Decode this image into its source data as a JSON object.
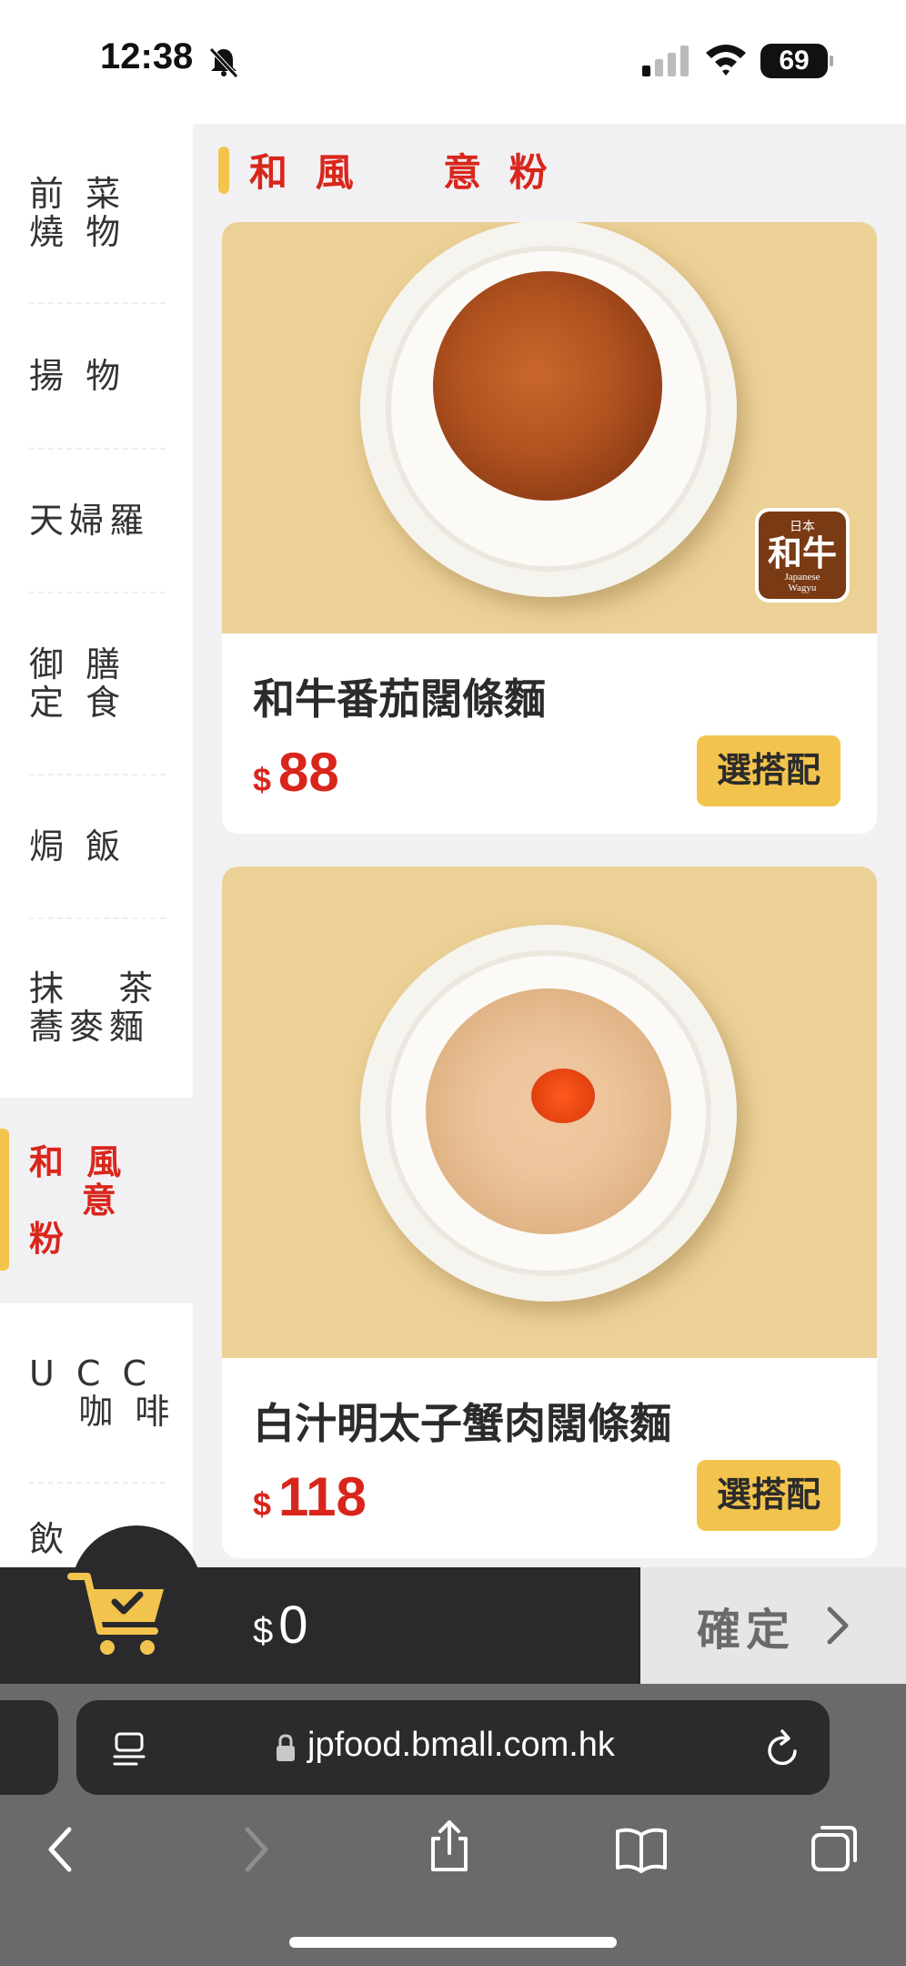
{
  "status_bar": {
    "time": "12:38",
    "battery": "69"
  },
  "sidebar": {
    "items": [
      {
        "label": "前 菜\n燒 物",
        "active": false
      },
      {
        "label": "揚 物",
        "active": false
      },
      {
        "label": "天婦羅",
        "active": false
      },
      {
        "label": "御 膳\n定 食",
        "active": false
      },
      {
        "label": "焗 飯",
        "active": false
      },
      {
        "label": "抹   茶\n蕎麥麵",
        "active": false
      },
      {
        "label": "和 風\n   意\n粉",
        "active": true
      },
      {
        "label": "U C C\n   咖 啡",
        "active": false
      },
      {
        "label": "飲",
        "active": false
      }
    ]
  },
  "section": {
    "title": "和 風    意 粉"
  },
  "products": [
    {
      "name": "和牛番茄闊條麵",
      "currency": "$",
      "price": "88",
      "button": "選搭配",
      "badge": {
        "top": "日本",
        "main": "和牛",
        "sub1": "Japanese",
        "sub2": "Wagyu"
      }
    },
    {
      "name": "白汁明太子蟹肉闊條麵",
      "currency": "$",
      "price": "118",
      "button": "選搭配"
    }
  ],
  "cart": {
    "currency": "$",
    "total": "0",
    "confirm": "確定"
  },
  "browser": {
    "url": "jpfood.bmall.com.hk"
  },
  "colors": {
    "accent_red": "#d9261c",
    "accent_yellow": "#f3c44d",
    "bar_dark": "#2a2a2c"
  }
}
